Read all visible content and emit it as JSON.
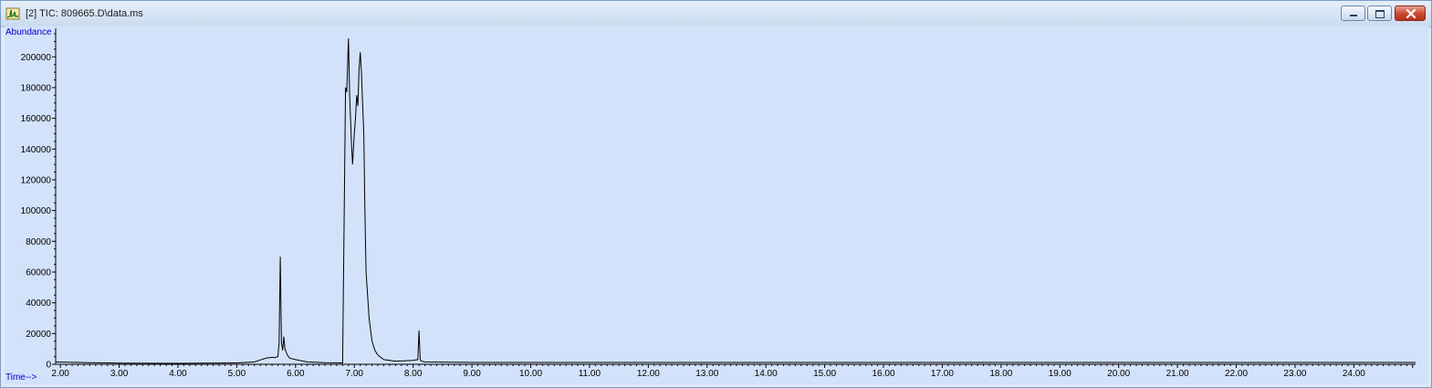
{
  "window": {
    "title": "[2] TIC: 809665.D\\data.ms",
    "icon": "chromatogram-app-icon",
    "controls": [
      "minimize-icon",
      "maximize-icon",
      "close-icon"
    ]
  },
  "colors": {
    "plot_bg": "#d3e2fb",
    "trace": "#000000",
    "axis_label": "#0000cc",
    "close_button": "#c7462d"
  },
  "chart_data": {
    "type": "line",
    "ylabel": "Abundance",
    "xlabel": "Time-->",
    "xlim": [
      1.92,
      25.05
    ],
    "ylim": [
      0,
      215000
    ],
    "x_ticks": [
      "2.00",
      "3.00",
      "4.00",
      "5.00",
      "6.00",
      "7.00",
      "8.00",
      "9.00",
      "10.00",
      "11.00",
      "12.00",
      "13.00",
      "14.00",
      "15.00",
      "16.00",
      "17.00",
      "18.00",
      "19.00",
      "20.00",
      "21.00",
      "22.00",
      "23.00",
      "24.00"
    ],
    "y_ticks": [
      "0",
      "20000",
      "40000",
      "60000",
      "80000",
      "100000",
      "120000",
      "140000",
      "160000",
      "180000",
      "200000"
    ],
    "grid": false,
    "series": [
      {
        "x": [
          1.92,
          2.5,
          3.0,
          4.0,
          5.0,
          5.3,
          5.4,
          5.5,
          5.6,
          5.65,
          5.7,
          5.72,
          5.74,
          5.76,
          5.78,
          5.8,
          5.82,
          5.84,
          5.86,
          5.88,
          5.9,
          6.0,
          6.2,
          6.5,
          6.8,
          6.85,
          6.87,
          6.9,
          6.92,
          6.95,
          6.97,
          7.0,
          7.02,
          7.04,
          7.06,
          7.08,
          7.1,
          7.12,
          7.14,
          7.16,
          7.18,
          7.2,
          7.25,
          7.3,
          7.35,
          7.4,
          7.5,
          7.7,
          8.0,
          8.08,
          8.1,
          8.12,
          8.14,
          8.2,
          9.0,
          12.0,
          16.0,
          20.0,
          24.0,
          25.05
        ],
        "y": [
          1500,
          1000,
          800,
          600,
          900,
          1500,
          2800,
          4000,
          4500,
          4300,
          5000,
          14000,
          70000,
          14000,
          9000,
          18000,
          10000,
          8000,
          6000,
          5000,
          4000,
          3000,
          1500,
          1000,
          900,
          180000,
          177000,
          212000,
          175000,
          145000,
          130000,
          150000,
          160000,
          175000,
          168000,
          192000,
          203000,
          190000,
          170000,
          150000,
          100000,
          60000,
          30000,
          15000,
          9000,
          6000,
          3000,
          2000,
          2500,
          3000,
          22000,
          3000,
          2000,
          1500,
          1200,
          1200,
          1200,
          1200,
          1200,
          1200
        ]
      }
    ]
  }
}
